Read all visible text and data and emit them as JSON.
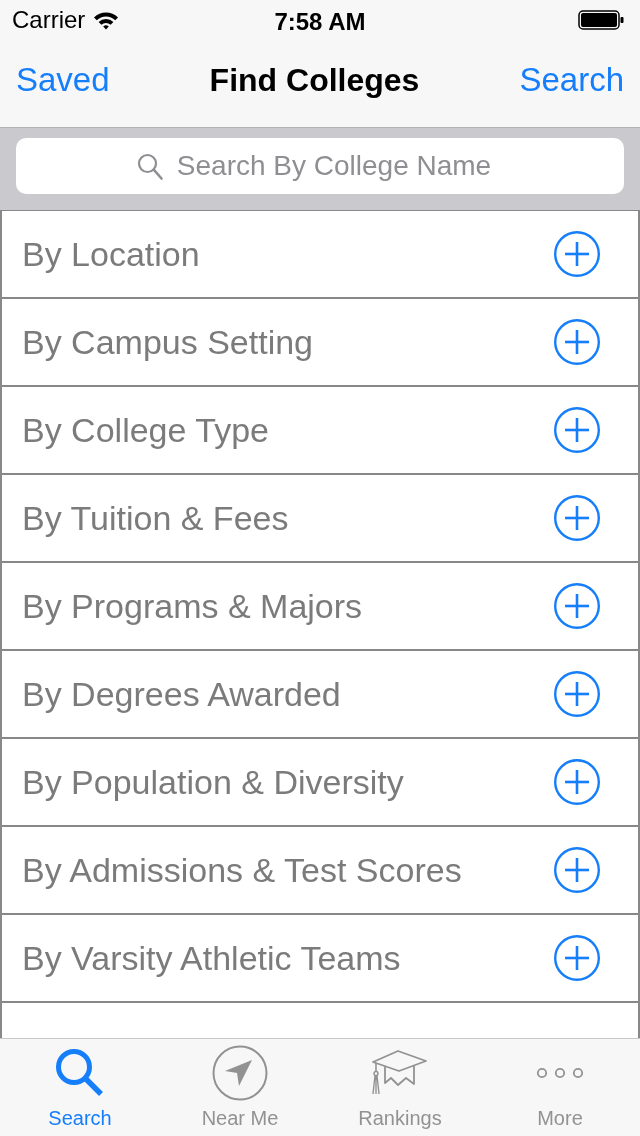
{
  "status_bar": {
    "carrier": "Carrier",
    "time": "7:58 AM"
  },
  "nav_bar": {
    "left_button": "Saved",
    "title": "Find Colleges",
    "right_button": "Search"
  },
  "search": {
    "placeholder": "Search By College Name"
  },
  "filters": [
    {
      "label": "By Location"
    },
    {
      "label": "By Campus Setting"
    },
    {
      "label": "By College Type"
    },
    {
      "label": "By Tuition & Fees"
    },
    {
      "label": "By Programs & Majors"
    },
    {
      "label": "By Degrees Awarded"
    },
    {
      "label": "By Population & Diversity"
    },
    {
      "label": "By Admissions & Test Scores"
    },
    {
      "label": "By Varsity Athletic Teams"
    }
  ],
  "tabs": [
    {
      "label": "Search",
      "kind": "search",
      "selected": true
    },
    {
      "label": "Near Me",
      "kind": "near",
      "selected": false
    },
    {
      "label": "Rankings",
      "kind": "rankings",
      "selected": false
    },
    {
      "label": "More",
      "kind": "more",
      "selected": false
    }
  ]
}
